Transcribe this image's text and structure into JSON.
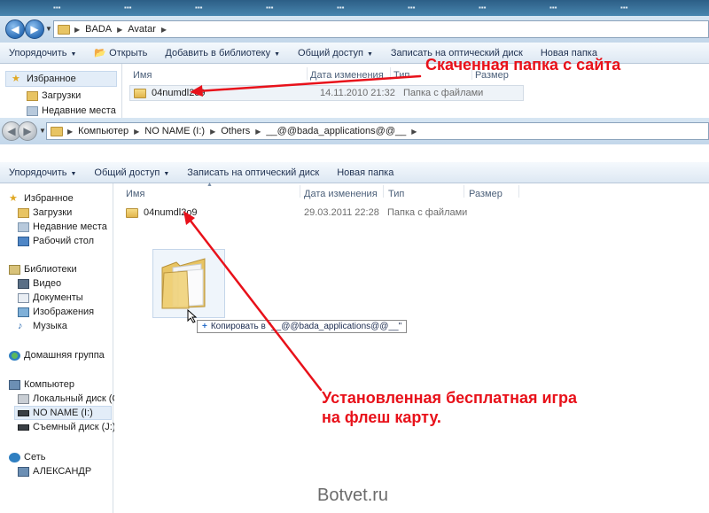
{
  "window_top": {
    "address": [
      "BADA",
      "Avatar"
    ],
    "toolbar": [
      "Упорядочить",
      "Открыть",
      "Добавить в библиотеку",
      "Общий доступ",
      "Записать на оптический диск",
      "Новая папка"
    ],
    "nav": {
      "favorites": "Избранное",
      "downloads": "Загрузки",
      "recent": "Недавние места"
    },
    "columns": {
      "name": "Имя",
      "date": "Дата изменения",
      "type": "Тип",
      "size": "Размер"
    },
    "file": {
      "name": "04numdl2o9",
      "date": "14.11.2010 21:32",
      "type": "Папка с файлами"
    }
  },
  "window_main": {
    "address": [
      "Компьютер",
      "NO NAME (I:)",
      "Others",
      "__@@bada_applications@@__"
    ],
    "toolbar": [
      "Упорядочить",
      "Общий доступ",
      "Записать на оптический диск",
      "Новая папка"
    ],
    "nav": {
      "favorites": "Избранное",
      "downloads": "Загрузки",
      "recent": "Недавние места",
      "desktop": "Рабочий стол",
      "libraries": "Библиотеки",
      "video": "Видео",
      "documents": "Документы",
      "images": "Изображения",
      "music": "Музыка",
      "homegroup": "Домашняя группа",
      "computer": "Компьютер",
      "local_disk": "Локальный диск (C:)",
      "no_name": "NO NAME (I:)",
      "removable": "Съемный диск (J:)",
      "network": "Сеть",
      "pc": "АЛЕКСАНДР"
    },
    "columns": {
      "name": "Имя",
      "date": "Дата изменения",
      "type": "Тип",
      "size": "Размер"
    },
    "file": {
      "name": "04numdl2o9",
      "date": "29.03.2011 22:28",
      "type": "Папка с файлами"
    },
    "drag_tooltip": "Копировать в \"__@@bada_applications@@__\""
  },
  "annotations": {
    "downloaded": "Скаченная папка с сайта",
    "installed_line1": "Установленная бесплатная игра",
    "installed_line2": "на флеш карту."
  },
  "watermark": "Botvet.ru",
  "colors": {
    "annotation": "#e8111a",
    "toolbar_text": "#1e3050"
  }
}
